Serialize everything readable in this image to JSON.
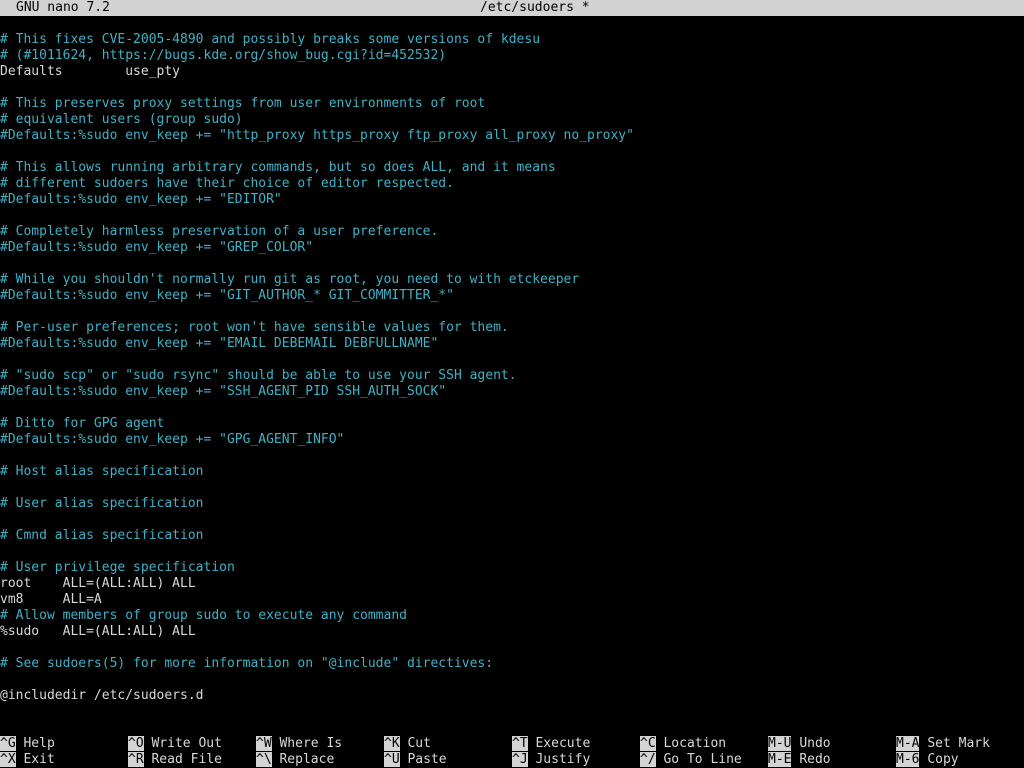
{
  "title_bar": {
    "app": "GNU nano 7.2",
    "filename": "/etc/sudoers *"
  },
  "lines": [
    {
      "text": "# This fixes CVE-2005-4890 and possibly breaks some versions of kdesu",
      "kind": "comment"
    },
    {
      "text": "# (#1011624, https://bugs.kde.org/show_bug.cgi?id=452532)",
      "kind": "comment"
    },
    {
      "text": "Defaults        use_pty",
      "kind": "plain"
    },
    {
      "text": "",
      "kind": "plain"
    },
    {
      "text": "# This preserves proxy settings from user environments of root",
      "kind": "comment"
    },
    {
      "text": "# equivalent users (group sudo)",
      "kind": "comment"
    },
    {
      "text": "#Defaults:%sudo env_keep += \"http_proxy https_proxy ftp_proxy all_proxy no_proxy\"",
      "kind": "comment"
    },
    {
      "text": "",
      "kind": "plain"
    },
    {
      "text": "# This allows running arbitrary commands, but so does ALL, and it means",
      "kind": "comment"
    },
    {
      "text": "# different sudoers have their choice of editor respected.",
      "kind": "comment"
    },
    {
      "text": "#Defaults:%sudo env_keep += \"EDITOR\"",
      "kind": "comment"
    },
    {
      "text": "",
      "kind": "plain"
    },
    {
      "text": "# Completely harmless preservation of a user preference.",
      "kind": "comment"
    },
    {
      "text": "#Defaults:%sudo env_keep += \"GREP_COLOR\"",
      "kind": "comment"
    },
    {
      "text": "",
      "kind": "plain"
    },
    {
      "text": "# While you shouldn't normally run git as root, you need to with etckeeper",
      "kind": "comment"
    },
    {
      "text": "#Defaults:%sudo env_keep += \"GIT_AUTHOR_* GIT_COMMITTER_*\"",
      "kind": "comment"
    },
    {
      "text": "",
      "kind": "plain"
    },
    {
      "text": "# Per-user preferences; root won't have sensible values for them.",
      "kind": "comment"
    },
    {
      "text": "#Defaults:%sudo env_keep += \"EMAIL DEBEMAIL DEBFULLNAME\"",
      "kind": "comment"
    },
    {
      "text": "",
      "kind": "plain"
    },
    {
      "text": "# \"sudo scp\" or \"sudo rsync\" should be able to use your SSH agent.",
      "kind": "comment"
    },
    {
      "text": "#Defaults:%sudo env_keep += \"SSH_AGENT_PID SSH_AUTH_SOCK\"",
      "kind": "comment"
    },
    {
      "text": "",
      "kind": "plain"
    },
    {
      "text": "# Ditto for GPG agent",
      "kind": "comment"
    },
    {
      "text": "#Defaults:%sudo env_keep += \"GPG_AGENT_INFO\"",
      "kind": "comment"
    },
    {
      "text": "",
      "kind": "plain"
    },
    {
      "text": "# Host alias specification",
      "kind": "comment"
    },
    {
      "text": "",
      "kind": "plain"
    },
    {
      "text": "# User alias specification",
      "kind": "comment"
    },
    {
      "text": "",
      "kind": "plain"
    },
    {
      "text": "# Cmnd alias specification",
      "kind": "comment"
    },
    {
      "text": "",
      "kind": "plain"
    },
    {
      "text": "# User privilege specification",
      "kind": "comment"
    },
    {
      "text": "root    ALL=(ALL:ALL) ALL",
      "kind": "plain"
    },
    {
      "text": "vm8     ALL=A",
      "kind": "plain"
    },
    {
      "text": "# Allow members of group sudo to execute any command",
      "kind": "comment"
    },
    {
      "text": "%sudo   ALL=(ALL:ALL) ALL",
      "kind": "plain"
    },
    {
      "text": "",
      "kind": "plain"
    },
    {
      "text": "# See sudoers(5) for more information on \"@include\" directives:",
      "kind": "comment"
    },
    {
      "text": "",
      "kind": "plain"
    },
    {
      "text": "@includedir /etc/sudoers.d",
      "kind": "plain"
    }
  ],
  "shortcuts": [
    {
      "key": "^G",
      "label": "Help",
      "name": "help"
    },
    {
      "key": "^O",
      "label": "Write Out",
      "name": "write-out"
    },
    {
      "key": "^W",
      "label": "Where Is",
      "name": "where-is"
    },
    {
      "key": "^K",
      "label": "Cut",
      "name": "cut"
    },
    {
      "key": "^T",
      "label": "Execute",
      "name": "execute"
    },
    {
      "key": "^C",
      "label": "Location",
      "name": "location"
    },
    {
      "key": "M-U",
      "label": "Undo",
      "name": "undo"
    },
    {
      "key": "M-A",
      "label": "Set Mark",
      "name": "set-mark"
    },
    {
      "key": "^X",
      "label": "Exit",
      "name": "exit"
    },
    {
      "key": "^R",
      "label": "Read File",
      "name": "read-file"
    },
    {
      "key": "^\\",
      "label": "Replace",
      "name": "replace"
    },
    {
      "key": "^U",
      "label": "Paste",
      "name": "paste"
    },
    {
      "key": "^J",
      "label": "Justify",
      "name": "justify"
    },
    {
      "key": "^/",
      "label": "Go To Line",
      "name": "go-to-line"
    },
    {
      "key": "M-E",
      "label": "Redo",
      "name": "redo"
    },
    {
      "key": "M-6",
      "label": "Copy",
      "name": "copy"
    }
  ],
  "colors": {
    "comment": "#3fb1c6",
    "text": "#d8d8d8",
    "bar_background": "#d3d3d3",
    "background": "#000000"
  }
}
